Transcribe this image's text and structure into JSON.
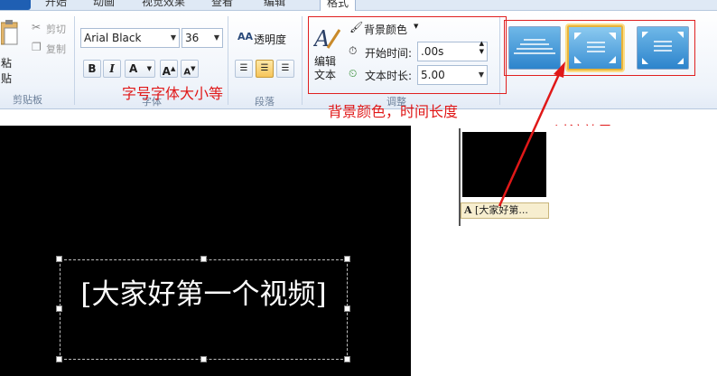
{
  "tabs": [
    {
      "label": "开始"
    },
    {
      "label": "动画"
    },
    {
      "label": "视觉效果"
    },
    {
      "label": "查看"
    },
    {
      "label": "编辑"
    },
    {
      "label": "格式"
    }
  ],
  "clipboard": {
    "paste_label": "粘贴",
    "cut_label": "剪切",
    "copy_label": "复制",
    "group_label": "剪贴板"
  },
  "font": {
    "family_value": "Arial Black",
    "size_value": "36",
    "transparency_label": "透明度",
    "bold_label": "B",
    "italic_label": "I",
    "color_label": "A",
    "grow_label": "A",
    "shrink_label": "A",
    "group_label": "字体",
    "paragraph_group_label": "段落"
  },
  "adjust": {
    "edit_text_label": "编辑\n文本",
    "bg_color_label": "背景颜色",
    "start_time_label": "开始时间:",
    "start_time_value": ".00s",
    "duration_label": "文本时长:",
    "duration_value": "5.00",
    "group_label": "调整"
  },
  "annotations": {
    "font_note": "字号字体大小等",
    "bg_note": "背景颜色，时间长度",
    "transition_note": "过渡效果"
  },
  "preview": {
    "caption": "[大家好第一个视频]"
  },
  "storyboard": {
    "clip_tag": "[大家好第..."
  },
  "colors": {
    "annotation_red": "#e01818",
    "selected_border": "#e8b33a",
    "preview_bg": "#000000"
  }
}
